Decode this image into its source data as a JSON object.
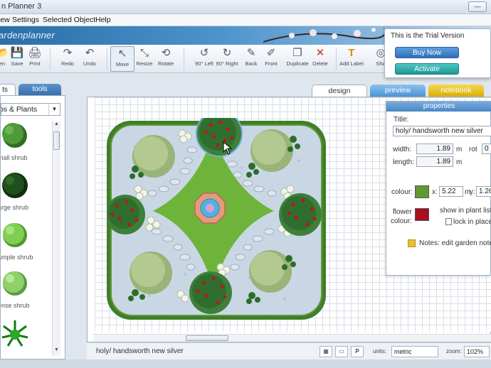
{
  "window": {
    "title": "n Planner 3",
    "minimize_glyph": "—",
    "maximize_glyph": "☐",
    "close_glyph": "✕"
  },
  "menu": [
    "iew",
    "Settings",
    "Selected Object",
    "Help"
  ],
  "banner": {
    "logo": "ardenplanner"
  },
  "toolbar": {
    "items": [
      {
        "label": "en",
        "icon": "open-folder-icon",
        "glyph": "📂"
      },
      {
        "label": "Save",
        "icon": "save-icon",
        "glyph": "💾"
      },
      {
        "label": "Print",
        "icon": "print-icon",
        "glyph": "🖨"
      },
      {
        "label": "Redo",
        "icon": "redo-icon",
        "glyph": "↷"
      },
      {
        "label": "Undo",
        "icon": "undo-icon",
        "glyph": "↶"
      },
      {
        "label": "Move",
        "icon": "move-cursor-icon",
        "glyph": "↖"
      },
      {
        "label": "Resize",
        "icon": "resize-icon",
        "glyph": "⤡"
      },
      {
        "label": "Rotate",
        "icon": "rotate-icon",
        "glyph": "⟲"
      },
      {
        "label": "90° Left",
        "icon": "rotate-left-icon",
        "glyph": "↺"
      },
      {
        "label": "90° Right",
        "icon": "rotate-right-icon",
        "glyph": "↻"
      },
      {
        "label": "Back",
        "icon": "send-back-icon",
        "glyph": "✎"
      },
      {
        "label": "Front",
        "icon": "bring-front-icon",
        "glyph": "✐"
      },
      {
        "label": "Duplicate",
        "icon": "duplicate-icon",
        "glyph": "❐"
      },
      {
        "label": "Delete",
        "icon": "delete-icon",
        "glyph": "✕"
      },
      {
        "label": "Add Label",
        "icon": "add-label-icon",
        "glyph": "T"
      },
      {
        "label": "Sha",
        "icon": "share-icon",
        "glyph": "◎"
      }
    ]
  },
  "trial": {
    "message": "This is the Trial Version",
    "buy_label": "Buy Now",
    "activate_label": "Activate"
  },
  "left_panel": {
    "tabs": [
      {
        "label": "ts"
      },
      {
        "label": "tools"
      }
    ],
    "category": "bs & Plants",
    "items": [
      {
        "label": "mall shrub",
        "color": "#4f9a3b",
        "dark": "#2f6d22"
      },
      {
        "label": "arge shrub",
        "color": "#1f4f1c",
        "dark": "#0f2f0e"
      },
      {
        "label": "ample shrub",
        "color": "#7fcf55",
        "dark": "#4e9a2e"
      },
      {
        "label": "ense shrub",
        "color": "#8fd06a",
        "dark": "#5a9c3e"
      },
      {
        "label": "",
        "color": "#2ea62a",
        "dark": "#117a12"
      }
    ]
  },
  "right_tabs": [
    {
      "label": "design",
      "active": true
    },
    {
      "label": "preview",
      "active": false
    },
    {
      "label": "notebook",
      "active": false
    }
  ],
  "properties": {
    "header": "properties",
    "title_label": "Title:",
    "title_value": "holy/ handsworth new silver",
    "width_label": "width:",
    "width_value": "1.89",
    "width_unit": "m",
    "rot_label": "rot",
    "rot_value": "0",
    "length_label": "length:",
    "length_value": "1.89",
    "length_unit": "m",
    "colour_label": "colour:",
    "colour_value": "#5f9a2e",
    "x_label": "x:",
    "x_value": "5.22",
    "x_unit": "m",
    "y_label": "y:",
    "y_value": "1.26",
    "flower_label_1": "flower",
    "flower_label_2": "colour:",
    "flower_colour": "#a80f1f",
    "show_label": "show in plant list",
    "lock_label": "lock in place",
    "notes_label": "Notes: edit garden note"
  },
  "status": {
    "selected_text": "holy/ handsworth new silver",
    "units_label": "units:",
    "units_value": "metric",
    "zoom_label": "zoom:",
    "zoom_value": "102%"
  },
  "colors": {
    "accent_blue": "#4a86c5",
    "teal": "#1e9694",
    "notebook_tab": "#e7c11b",
    "lawn": "#6fb43a",
    "gravel": "#c9d7e4",
    "hedge": "#3f7f2a"
  }
}
